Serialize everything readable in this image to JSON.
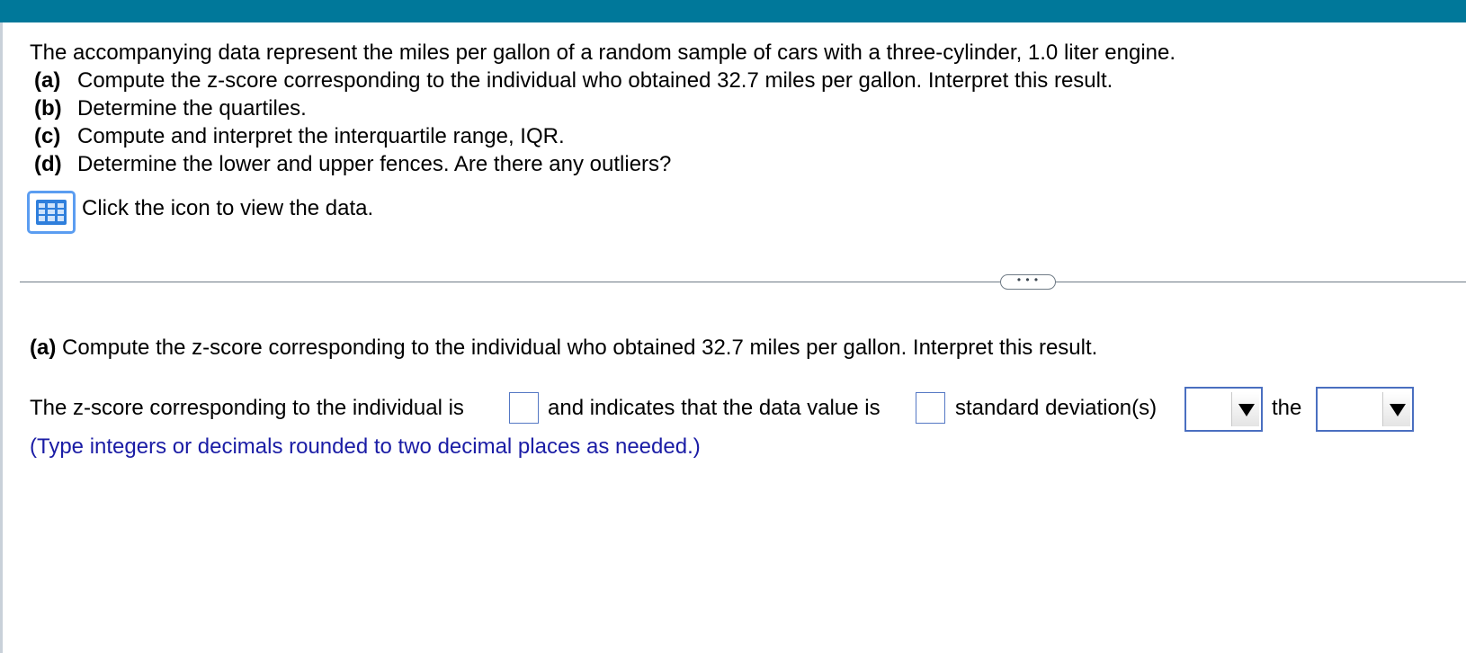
{
  "colors": {
    "header": "#00789a",
    "hint_text": "#1a1ca5",
    "field_border": "#5578c4",
    "icon_blue": "#2f7fdc"
  },
  "question": {
    "intro": "The accompanying data represent the miles per gallon of a random sample of cars with a three-cylinder, 1.0 liter engine.",
    "parts": [
      {
        "label": "(a)",
        "text": "Compute the z-score corresponding to the individual who obtained 32.7 miles per gallon. Interpret this result."
      },
      {
        "label": "(b)",
        "text": "Determine the quartiles."
      },
      {
        "label": "(c)",
        "text": "Compute and interpret the interquartile range, IQR."
      },
      {
        "label": "(d)",
        "text": "Determine the lower and upper fences. Are there any outliers?"
      }
    ],
    "data_link": {
      "icon": "data-table-icon",
      "text": "Click the icon to view the data."
    }
  },
  "divider": {
    "more_label": "• • •"
  },
  "answer": {
    "part_label": "(a)",
    "part_text": "Compute the z-score corresponding to the individual who obtained 32.7 miles per gallon. Interpret this result.",
    "sentence_1": "The z-score corresponding to the individual is",
    "sentence_2": "and indicates that the data value is",
    "sentence_3": "standard deviation(s)",
    "sentence_4": "the",
    "zscore_value": "",
    "sd_count_value": "",
    "direction_selected": "",
    "reference_selected": "",
    "hint": "(Type integers or decimals rounded to two decimal places as needed.)"
  }
}
